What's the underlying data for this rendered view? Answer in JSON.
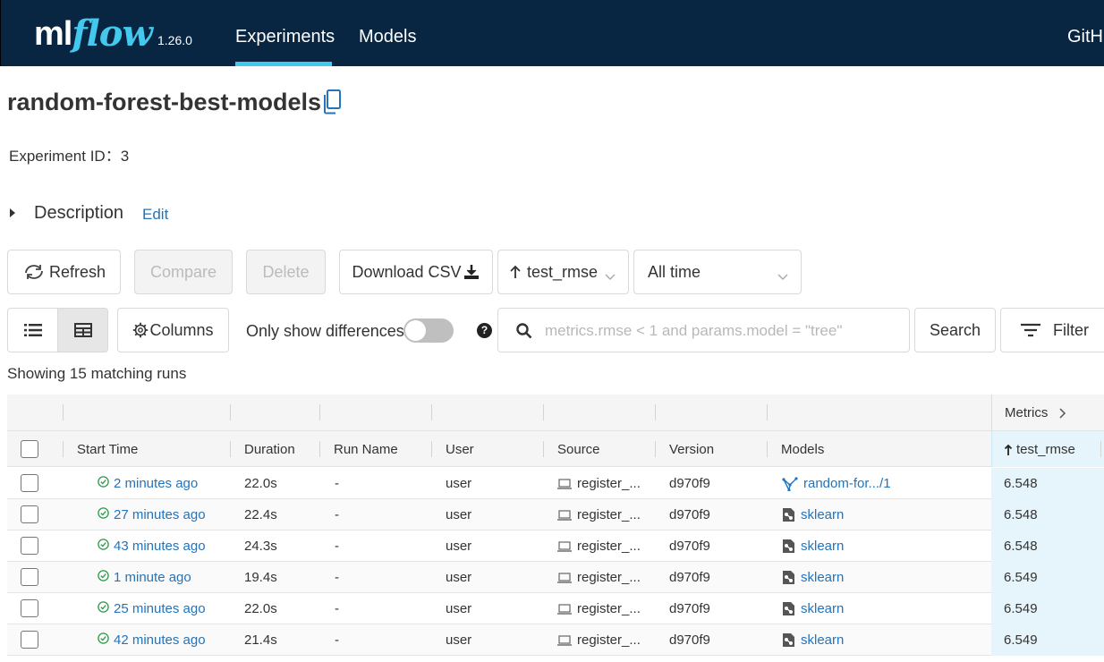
{
  "header": {
    "logo_ml": "ml",
    "logo_flow": "flow",
    "version": "1.26.0",
    "nav": [
      {
        "label": "Experiments",
        "active": true
      },
      {
        "label": "Models",
        "active": false
      }
    ],
    "github_label": "GitH"
  },
  "experiment": {
    "name": "random-forest-best-models",
    "id_text": "Experiment ID：3",
    "description_label": "Description",
    "edit_label": "Edit"
  },
  "toolbar": {
    "refresh": "Refresh",
    "compare": "Compare",
    "delete": "Delete",
    "download_csv": "Download CSV",
    "sort_value": "test_rmse",
    "time_value": "All time",
    "columns": "Columns",
    "only_diff": "Only show differences",
    "search_placeholder": "metrics.rmse < 1 and params.model = \"tree\"",
    "search": "Search",
    "filter": "Filter",
    "help": "?"
  },
  "showing_text": "Showing 15 matching runs",
  "table": {
    "group_header": "Metrics",
    "columns": {
      "start_time": "Start Time",
      "duration": "Duration",
      "run_name": "Run Name",
      "user": "User",
      "source": "Source",
      "version": "Version",
      "models": "Models",
      "metric": "test_rmse"
    },
    "rows": [
      {
        "time": "2 minutes ago",
        "duration": "22.0s",
        "run_name": "-",
        "user": "user",
        "source": "register_...",
        "version": "d970f9",
        "model": "random-for.../1",
        "model_kind": "registered",
        "metric": "6.548"
      },
      {
        "time": "27 minutes ago",
        "duration": "22.4s",
        "run_name": "-",
        "user": "user",
        "source": "register_...",
        "version": "d970f9",
        "model": "sklearn",
        "model_kind": "sklearn",
        "metric": "6.548"
      },
      {
        "time": "43 minutes ago",
        "duration": "24.3s",
        "run_name": "-",
        "user": "user",
        "source": "register_...",
        "version": "d970f9",
        "model": "sklearn",
        "model_kind": "sklearn",
        "metric": "6.548"
      },
      {
        "time": "1 minute ago",
        "duration": "19.4s",
        "run_name": "-",
        "user": "user",
        "source": "register_...",
        "version": "d970f9",
        "model": "sklearn",
        "model_kind": "sklearn",
        "metric": "6.549"
      },
      {
        "time": "25 minutes ago",
        "duration": "22.0s",
        "run_name": "-",
        "user": "user",
        "source": "register_...",
        "version": "d970f9",
        "model": "sklearn",
        "model_kind": "sklearn",
        "metric": "6.549"
      },
      {
        "time": "42 minutes ago",
        "duration": "21.4s",
        "run_name": "-",
        "user": "user",
        "source": "register_...",
        "version": "d970f9",
        "model": "sklearn",
        "model_kind": "sklearn",
        "metric": "6.549"
      }
    ]
  },
  "colors": {
    "header_bg": "#082541",
    "accent": "#43c9ed",
    "link": "#2374bb",
    "success": "#2e9a4a",
    "metric_bg": "#e6f5fb"
  }
}
